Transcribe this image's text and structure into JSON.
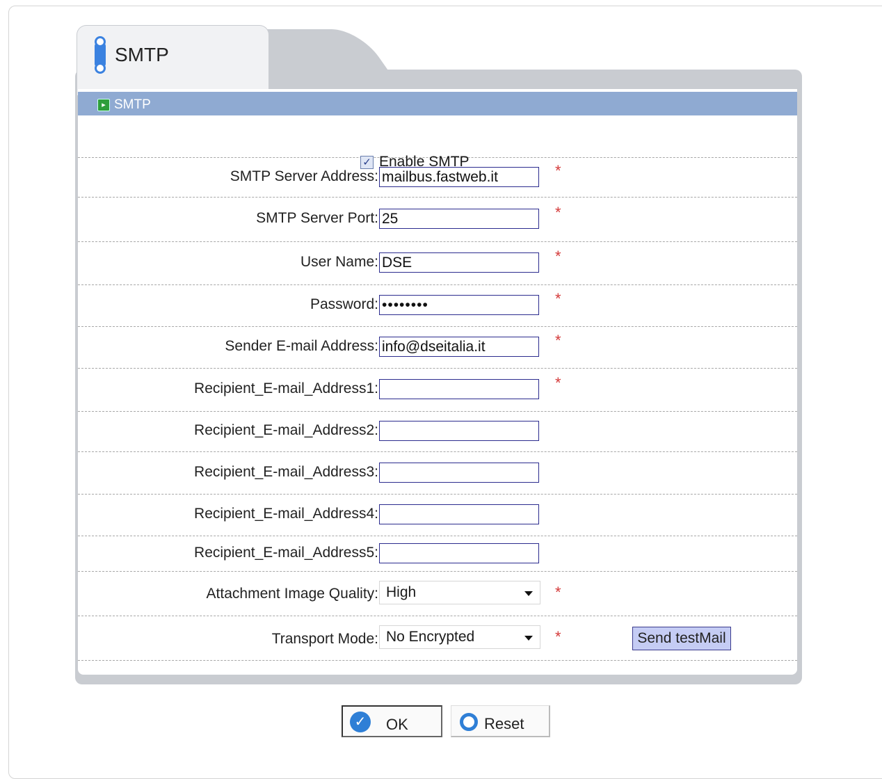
{
  "tab": {
    "title": "SMTP"
  },
  "section": {
    "title": "SMTP"
  },
  "enable": {
    "label": "Enable SMTP",
    "checked": true
  },
  "fields": [
    {
      "label": "SMTP Server Address:",
      "value": "mailbus.fastweb.it",
      "required": true
    },
    {
      "label": "SMTP Server Port:",
      "value": "25",
      "required": true
    },
    {
      "label": "User Name:",
      "value": "DSE",
      "required": true
    },
    {
      "label": "Password:",
      "value": "••••••••",
      "required": true
    },
    {
      "label": "Sender E-mail Address:",
      "value": "info@dseitalia.it",
      "required": true
    },
    {
      "label": "Recipient_E-mail_Address1:",
      "value": "",
      "required": true
    },
    {
      "label": "Recipient_E-mail_Address2:",
      "value": "",
      "required": false
    },
    {
      "label": "Recipient_E-mail_Address3:",
      "value": "",
      "required": false
    },
    {
      "label": "Recipient_E-mail_Address4:",
      "value": "",
      "required": false
    },
    {
      "label": "Recipient_E-mail_Address5:",
      "value": "",
      "required": false
    }
  ],
  "attachment_quality": {
    "label": "Attachment Image Quality:",
    "value": "High"
  },
  "transport_mode": {
    "label": "Transport Mode:",
    "value": "No Encrypted"
  },
  "required_marker": "*",
  "send_test_label": "Send testMail",
  "buttons": {
    "ok": "OK",
    "reset": "Reset"
  },
  "colors": {
    "section_bar": "#8faad2",
    "accent": "#2f7fd6",
    "required": "#d43a3a"
  }
}
